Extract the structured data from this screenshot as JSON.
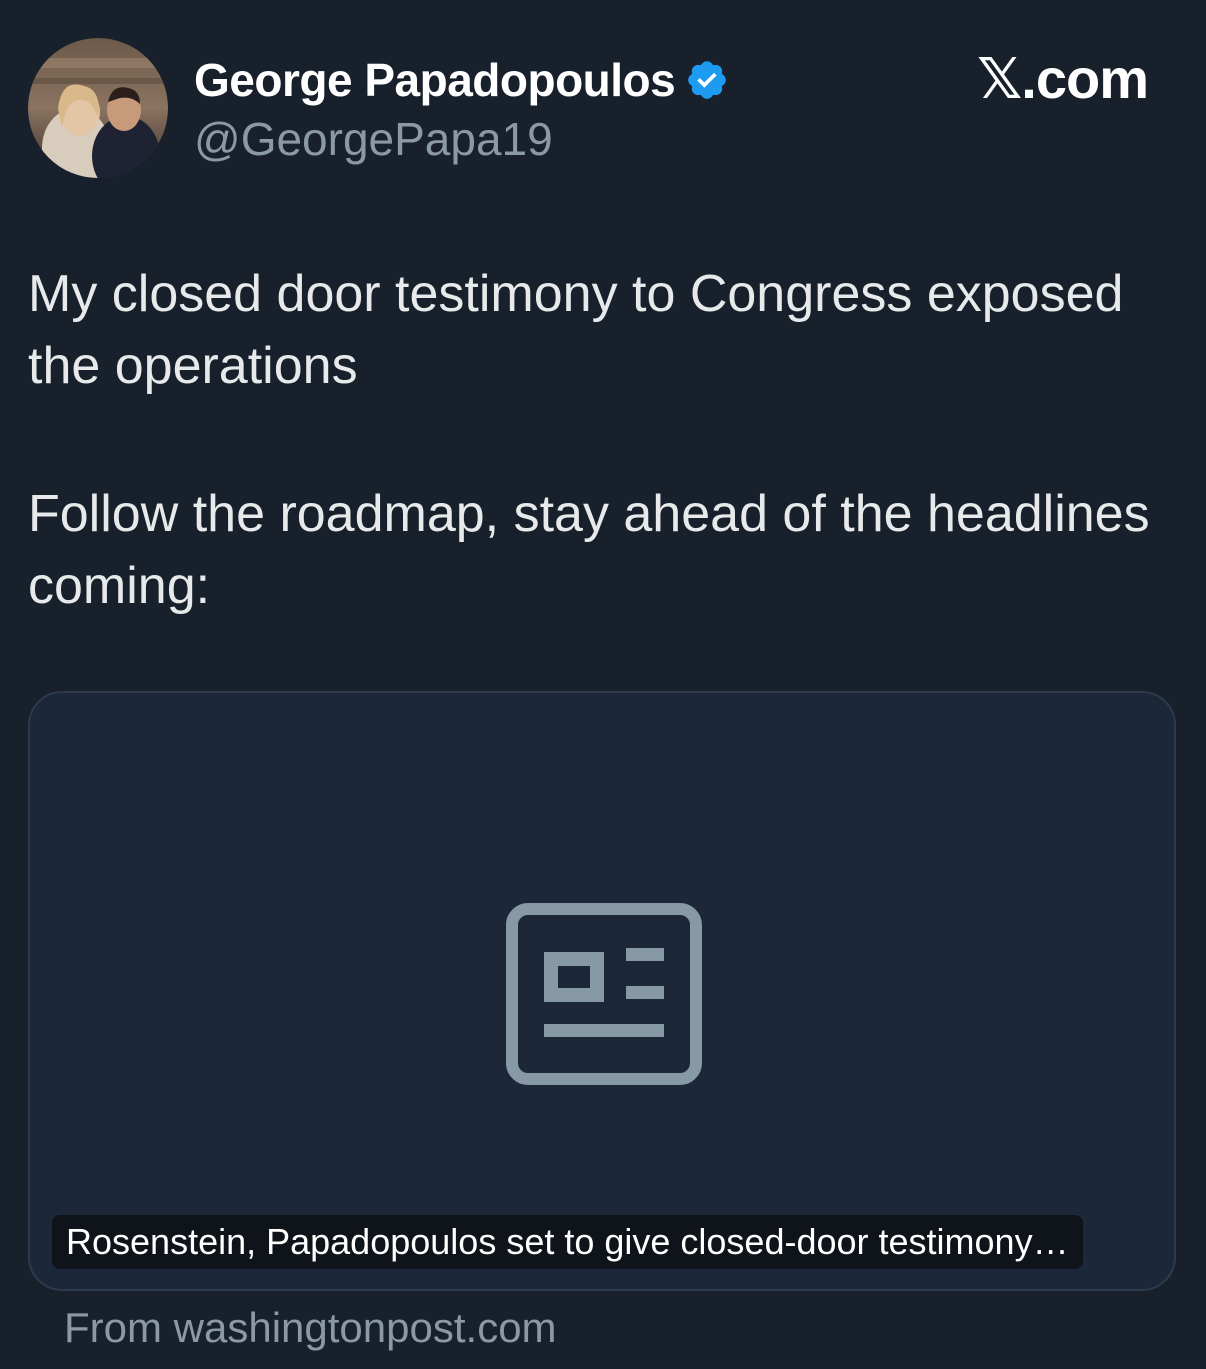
{
  "author": {
    "display_name": "George Papadopoulos",
    "handle": "@GeorgePapa19",
    "verified": true,
    "avatar_icon": "profile-photo",
    "verified_icon": "verified-badge-icon"
  },
  "brand": {
    "label": "𝕏.com"
  },
  "tweet": {
    "paragraphs": [
      "My closed door testimony to Congress exposed the operations",
      "Follow the roadmap, stay ahead of the headlines coming:"
    ]
  },
  "link_card": {
    "icon": "article-icon",
    "title": "Rosenstein, Papadopoulos set to give closed-door testimony…",
    "source": "From washingtonpost.com"
  },
  "colors": {
    "background": "#17202b",
    "card_background": "#1c2839",
    "verified_blue": "#1d9bf0",
    "secondary_text": "#8b98a5"
  }
}
